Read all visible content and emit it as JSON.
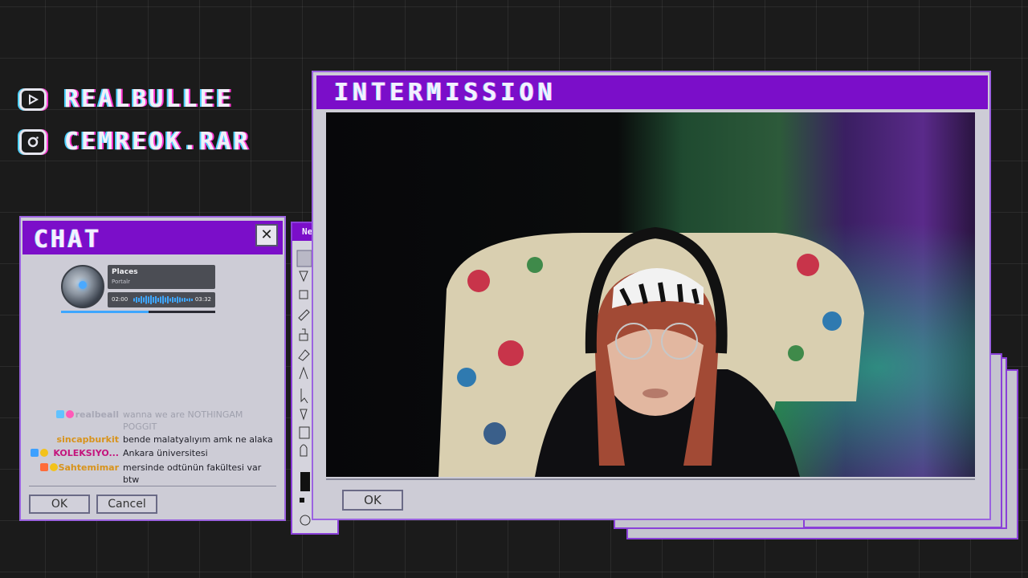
{
  "socials": [
    {
      "icon": "youtube-icon",
      "handle": "REALBULLEE"
    },
    {
      "icon": "instagram-icon",
      "handle": "CEMREOK.RAR"
    }
  ],
  "chat_window": {
    "title": "CHAT",
    "close_glyph": "✕",
    "ok_label": "OK",
    "cancel_label": "Cancel",
    "player": {
      "track": "Places",
      "artist": "Portalr",
      "elapsed": "02:00",
      "duration": "03:32",
      "progress": 0.57
    },
    "messages": [
      {
        "user": "realbeall",
        "text": "wanna we are NOTHINGAM",
        "text2": "POGGIT",
        "user_color": "#a8a8b6",
        "text_color": "#9fa0ad",
        "badges": [
          "#62c2ff",
          "#ff5ab8"
        ]
      },
      {
        "user": "sincapburkit",
        "text": "bende malatyalıyım amk ne alaka",
        "user_color": "#d8931b",
        "text_color": "#1f1f28",
        "badges": []
      },
      {
        "user": "KOLEKSIYO...",
        "text": "Ankara üniversitesi",
        "user_color": "#c4157d",
        "text_color": "#1f1f28",
        "badges": [
          "#3da0ff",
          "#f3c21b"
        ]
      },
      {
        "user": "Sahtemimar",
        "text": "mersinde odtünün fakültesi var",
        "text2": "btw",
        "user_color": "#d8931b",
        "text_color": "#1f1f28",
        "badges": [
          "#ff6c3a",
          "#f3c21b"
        ]
      }
    ]
  },
  "intermission_window": {
    "title": "INTERMISSION",
    "ok_label": "OK",
    "video_alt": "webcam feed"
  },
  "paint_window": {
    "title_fragment": "Ne"
  }
}
